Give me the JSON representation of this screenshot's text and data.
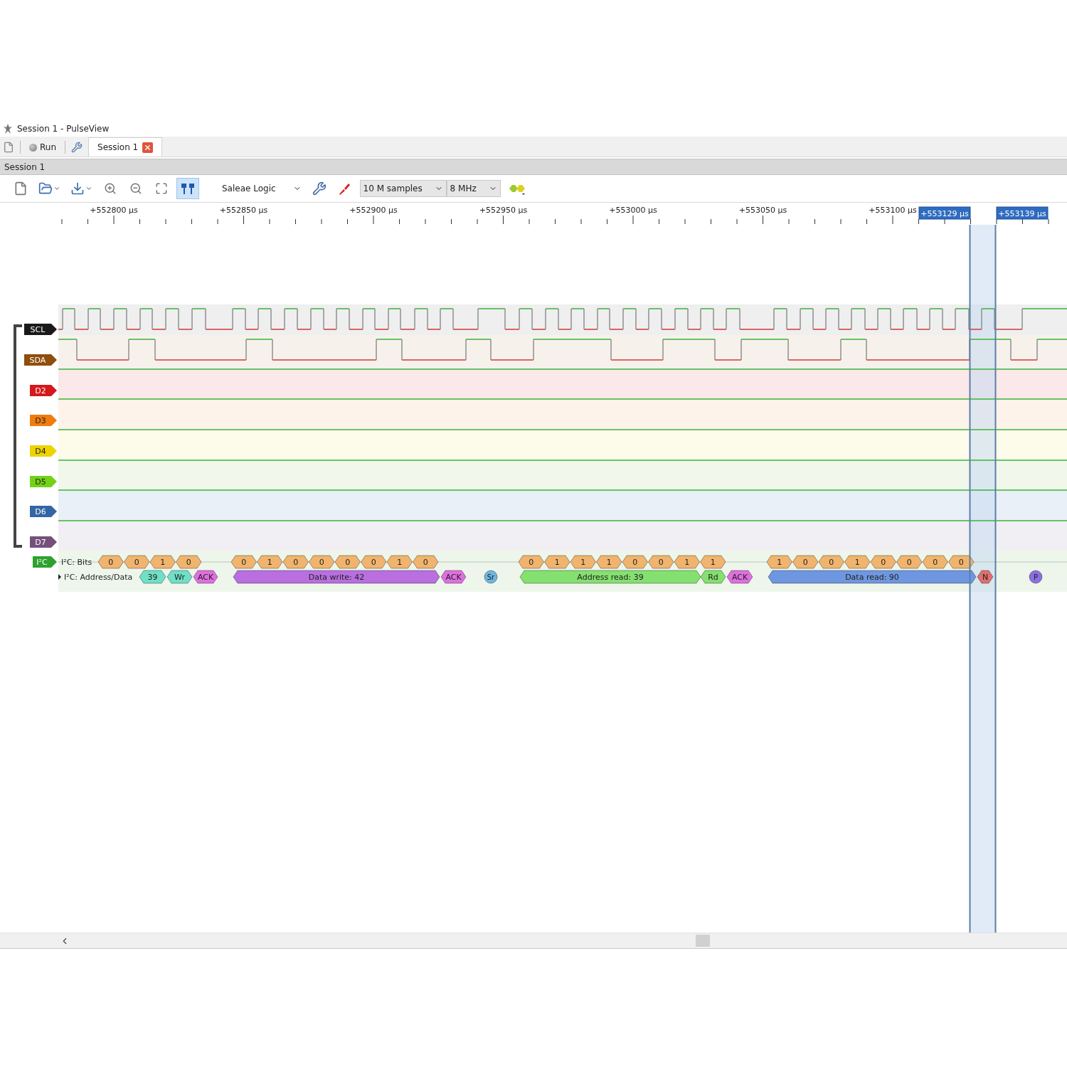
{
  "window": {
    "title": "Session 1 - PulseView"
  },
  "main_toolbar": {
    "run_label": "Run"
  },
  "tabs": [
    {
      "label": "Session 1",
      "selected": true
    }
  ],
  "session_header": "Session 1",
  "toolbar": {
    "device": "Saleae Logic",
    "samples": "10 M samples",
    "rate": "8 MHz",
    "cursors_on": true
  },
  "ruler": {
    "ticks": [
      "+552800 µs",
      "+552850 µs",
      "+552900 µs",
      "+552950 µs",
      "+553000 µs",
      "+553050 µs",
      "+553100 µs"
    ],
    "cursors": [
      "+553129 µs",
      "+553139 µs"
    ]
  },
  "channels": [
    {
      "name": "SCL",
      "color": "#1a1a1a"
    },
    {
      "name": "SDA",
      "color": "#8f4e0c"
    },
    {
      "name": "D2",
      "color": "#d4181c"
    },
    {
      "name": "D3",
      "color": "#f07c10"
    },
    {
      "name": "D4",
      "color": "#edd400"
    },
    {
      "name": "D5",
      "color": "#73d216"
    },
    {
      "name": "D6",
      "color": "#3465a4"
    },
    {
      "name": "D7",
      "color": "#75507b"
    }
  ],
  "decoder": {
    "name": "I²C",
    "color": "#2ea12e",
    "bits_row": {
      "label": "I²C: Bits",
      "groups": [
        [
          "0",
          "0",
          "1",
          "0"
        ],
        [
          "0",
          "1",
          "0",
          "0",
          "0",
          "0",
          "1",
          "0"
        ],
        [
          "0",
          "1",
          "1",
          "1",
          "0",
          "0",
          "1",
          "1"
        ],
        [
          "1",
          "0",
          "0",
          "1",
          "0",
          "0",
          "0",
          "0"
        ]
      ]
    },
    "data_row": {
      "label": "I²C: Address/Data",
      "annotations": [
        {
          "text": "39",
          "kind": "addresswr"
        },
        {
          "text": "Wr",
          "kind": "wr"
        },
        {
          "text": "ACK",
          "kind": "ack"
        },
        {
          "text": "Data write: 42",
          "kind": "datawr"
        },
        {
          "text": "ACK",
          "kind": "ack"
        },
        {
          "text": "Sr",
          "kind": "restart"
        },
        {
          "text": "Address read: 39",
          "kind": "addressrd"
        },
        {
          "text": "Rd",
          "kind": "rd"
        },
        {
          "text": "ACK",
          "kind": "ack"
        },
        {
          "text": "Data read: 90",
          "kind": "datard"
        },
        {
          "text": "N",
          "kind": "nack"
        },
        {
          "text": "P",
          "kind": "stop"
        }
      ]
    }
  }
}
